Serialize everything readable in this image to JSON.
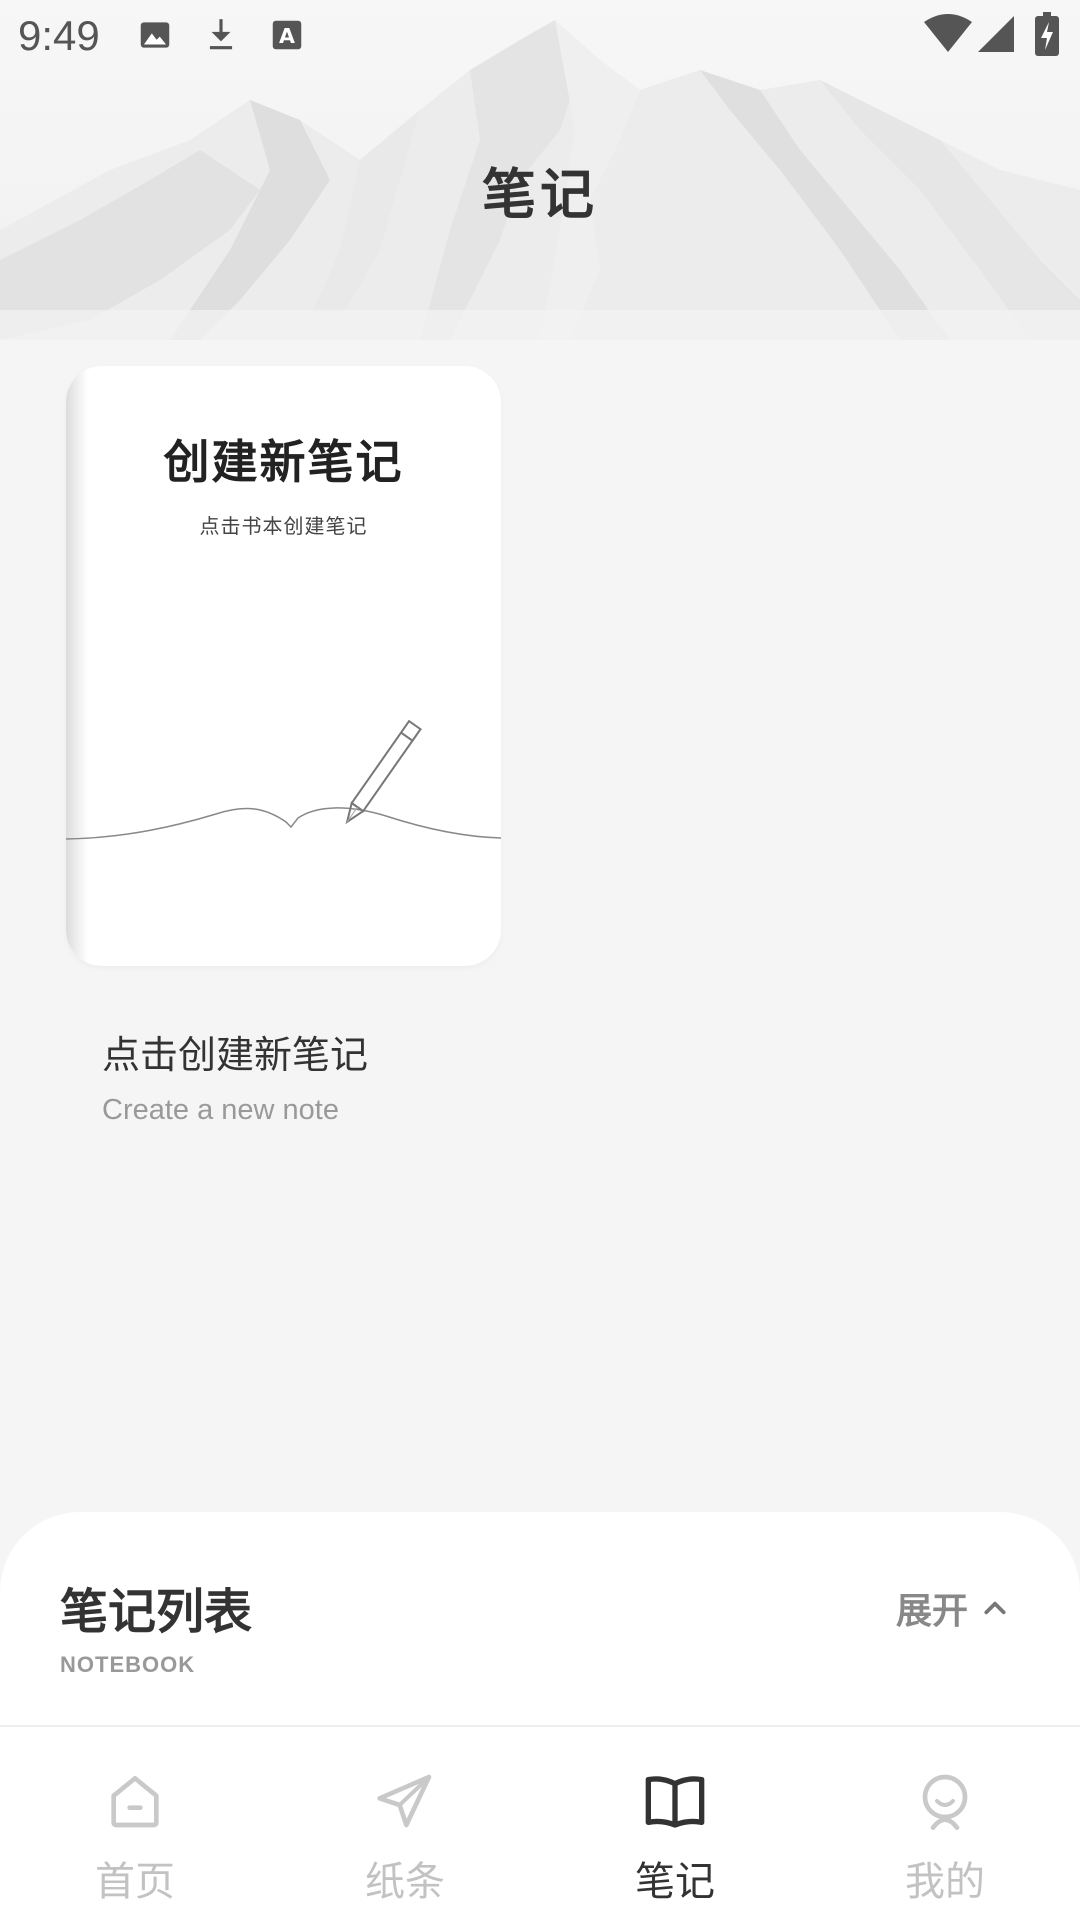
{
  "status_bar": {
    "time": "9:49",
    "icons": [
      "image-icon",
      "download-icon",
      "font-icon",
      "wifi-icon",
      "signal-icon",
      "battery-charging-icon"
    ]
  },
  "header": {
    "title": "笔记"
  },
  "create_card": {
    "book_title": "创建新笔记",
    "book_subtitle": "点击书本创建笔记",
    "label": "点击创建新笔记",
    "sublabel": "Create a new note"
  },
  "notebook": {
    "title": "笔记列表",
    "subtitle": "NOTEBOOK",
    "expand_label": "展开",
    "expand_icon": "chevron-up-icon"
  },
  "bottom_nav": {
    "items": [
      {
        "label": "首页",
        "icon": "home-icon",
        "active": false
      },
      {
        "label": "纸条",
        "icon": "paper-plane-icon",
        "active": false
      },
      {
        "label": "笔记",
        "icon": "book-icon",
        "active": true
      },
      {
        "label": "我的",
        "icon": "profile-icon",
        "active": false
      }
    ]
  },
  "colors": {
    "background": "#f5f5f5",
    "active": "#333333",
    "inactive": "#c2c2c2"
  }
}
